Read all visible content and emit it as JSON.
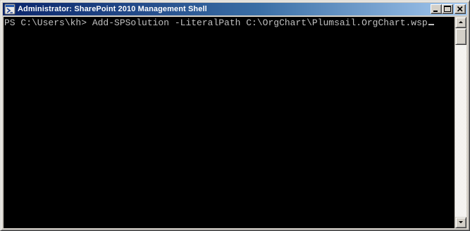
{
  "window": {
    "title": "Administrator: SharePoint 2010 Management Shell",
    "app_icon": "powershell-icon",
    "caption_buttons": [
      "minimize",
      "maximize",
      "close"
    ]
  },
  "console": {
    "line1": "PS C:\\Users\\kh> Add-SPSolution -LiteralPath C:\\OrgChart\\Plumsail.OrgChart.wsp",
    "foreground_color": "#c0c0c0",
    "background_color": "#000000"
  },
  "colors": {
    "titlebar_start": "#0a246a",
    "titlebar_end": "#a6caf0",
    "chrome": "#d4d0c8"
  }
}
